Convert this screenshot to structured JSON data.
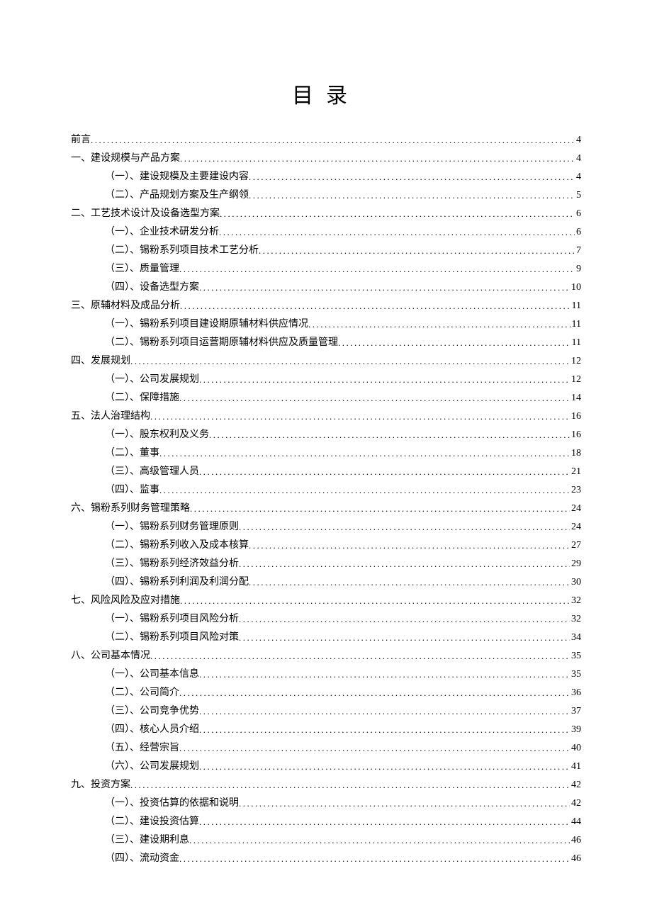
{
  "title": "目录",
  "toc": [
    {
      "level": 1,
      "label": "前言",
      "page": "4"
    },
    {
      "level": 1,
      "label": "一、建设规模与产品方案",
      "page": "4"
    },
    {
      "level": 2,
      "label": "（一）、建设规模及主要建设内容",
      "page": "4"
    },
    {
      "level": 2,
      "label": "（二）、产品规划方案及生产纲领",
      "page": "5"
    },
    {
      "level": 1,
      "label": "二、工艺技术设计及设备选型方案",
      "page": "6"
    },
    {
      "level": 2,
      "label": "（一）、企业技术研发分析",
      "page": "6"
    },
    {
      "level": 2,
      "label": "（二）、锡粉系列项目技术工艺分析",
      "page": "7"
    },
    {
      "level": 2,
      "label": "（三）、质量管理",
      "page": "9"
    },
    {
      "level": 2,
      "label": "（四）、设备选型方案",
      "page": "10"
    },
    {
      "level": 1,
      "label": "三、原辅材料及成品分析",
      "page": "11"
    },
    {
      "level": 2,
      "label": "（一）、锡粉系列项目建设期原辅材料供应情况",
      "page": "11"
    },
    {
      "level": 2,
      "label": "（二）、锡粉系列项目运营期原辅材料供应及质量管理",
      "page": "11"
    },
    {
      "level": 1,
      "label": "四、发展规划",
      "page": "12"
    },
    {
      "level": 2,
      "label": "（一）、公司发展规划",
      "page": "12"
    },
    {
      "level": 2,
      "label": "（二）、保障措施",
      "page": "14"
    },
    {
      "level": 1,
      "label": "五、法人治理结构",
      "page": "16"
    },
    {
      "level": 2,
      "label": "（一）、股东权利及义务",
      "page": "16"
    },
    {
      "level": 2,
      "label": "（二）、董事",
      "page": "18"
    },
    {
      "level": 2,
      "label": "（三）、高级管理人员",
      "page": "21"
    },
    {
      "level": 2,
      "label": "（四）、监事",
      "page": "23"
    },
    {
      "level": 1,
      "label": "六、锡粉系列财务管理策略",
      "page": "24"
    },
    {
      "level": 2,
      "label": "（一）、锡粉系列财务管理原则",
      "page": "24"
    },
    {
      "level": 2,
      "label": "（二）、锡粉系列收入及成本核算",
      "page": "27"
    },
    {
      "level": 2,
      "label": "（三）、锡粉系列经济效益分析",
      "page": "29"
    },
    {
      "level": 2,
      "label": "（四）、锡粉系列利润及利润分配",
      "page": "30"
    },
    {
      "level": 1,
      "label": "七、风险风险及应对措施",
      "page": "32"
    },
    {
      "level": 2,
      "label": "（一）、锡粉系列项目风险分析",
      "page": "32"
    },
    {
      "level": 2,
      "label": "（二）、锡粉系列项目风险对策",
      "page": "34"
    },
    {
      "level": 1,
      "label": "八、公司基本情况",
      "page": "35"
    },
    {
      "level": 2,
      "label": "（一）、公司基本信息",
      "page": "35"
    },
    {
      "level": 2,
      "label": "（二）、公司简介",
      "page": "36"
    },
    {
      "level": 2,
      "label": "（三）、公司竞争优势",
      "page": "37"
    },
    {
      "level": 2,
      "label": "（四）、核心人员介绍",
      "page": "39"
    },
    {
      "level": 2,
      "label": "（五）、经营宗旨",
      "page": "40"
    },
    {
      "level": 2,
      "label": "（六）、公司发展规划",
      "page": "41"
    },
    {
      "level": 1,
      "label": "九、投资方案",
      "page": "42"
    },
    {
      "level": 2,
      "label": "（一）、投资估算的依据和说明",
      "page": "42"
    },
    {
      "level": 2,
      "label": "（二）、建设投资估算",
      "page": "44"
    },
    {
      "level": 2,
      "label": "（三）、建设期利息",
      "page": "46"
    },
    {
      "level": 2,
      "label": "（四）、流动资金",
      "page": "46"
    }
  ]
}
